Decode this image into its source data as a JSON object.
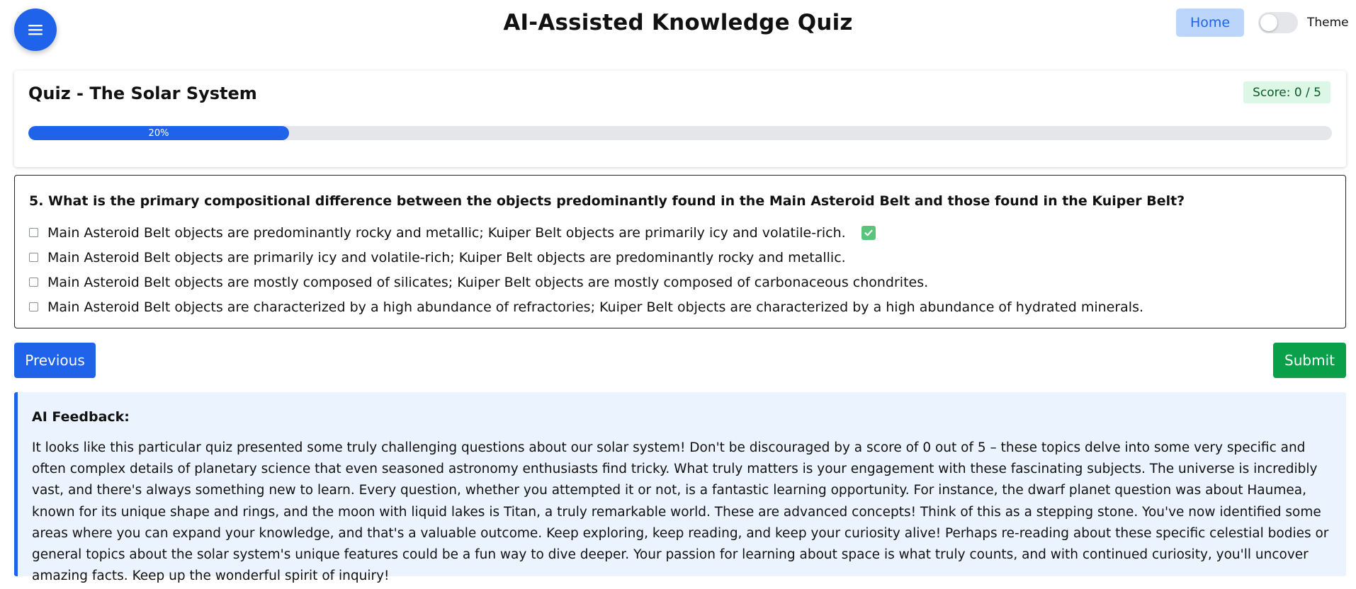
{
  "header": {
    "menu_icon": "hamburger-menu-icon",
    "title": "AI-Assisted Knowledge Quiz",
    "home_label": "Home",
    "theme_label": "Theme",
    "theme_toggle_on": false
  },
  "quiz": {
    "title": "Quiz - The Solar System",
    "score": "Score: 0 / 5",
    "progress": 0.2,
    "progress_label": "20%"
  },
  "question": {
    "text": "5. What is the primary compositional difference between the objects predominantly found in the Main Asteroid Belt and those found in the Kuiper Belt?",
    "options": [
      {
        "label": "Main Asteroid Belt objects are predominantly rocky and metallic; Kuiper Belt objects are primarily icy and volatile-rich.",
        "checked": false,
        "correct": true
      },
      {
        "label": "Main Asteroid Belt objects are primarily icy and volatile-rich; Kuiper Belt objects are predominantly rocky and metallic.",
        "checked": false,
        "correct": false
      },
      {
        "label": "Main Asteroid Belt objects are mostly composed of silicates; Kuiper Belt objects are mostly composed of carbonaceous chondrites.",
        "checked": false,
        "correct": false
      },
      {
        "label": "Main Asteroid Belt objects are characterized by a high abundance of refractories; Kuiper Belt objects are characterized by a high abundance of hydrated minerals.",
        "checked": false,
        "correct": false
      }
    ]
  },
  "buttons": {
    "previous_label": "Previous",
    "submit_label": "Submit"
  },
  "feedback": {
    "title": "AI Feedback:",
    "text": "It looks like this particular quiz presented some truly challenging questions about our solar system! Don't be discouraged by a score of 0 out of 5 – these topics delve into some very specific and often complex details of planetary science that even seasoned astronomy enthusiasts find tricky. What truly matters is your engagement with these fascinating subjects. The universe is incredibly vast, and there's always something new to learn. Every question, whether you attempted it or not, is a fantastic learning opportunity. For instance, the dwarf planet question was about Haumea, known for its unique shape and rings, and the moon with liquid lakes is Titan, a truly remarkable world. These are advanced concepts! Think of this as a stepping stone. You've now identified some areas where you can expand your knowledge, and that's a valuable outcome. Keep exploring, keep reading, and keep your curiosity alive! Perhaps re-reading about these specific celestial bodies or general topics about the solar system's unique features could be a fun way to dive deeper. Your passion for learning about space is what truly counts, and with continued curiosity, you'll uncover amazing facts. Keep up the wonderful spirit of inquiry!"
  },
  "colors": {
    "primary": "#1f63ea",
    "success": "#0aa04a",
    "score_bg": "#dcf7e5",
    "feedback_bg": "#ebf3fe"
  }
}
